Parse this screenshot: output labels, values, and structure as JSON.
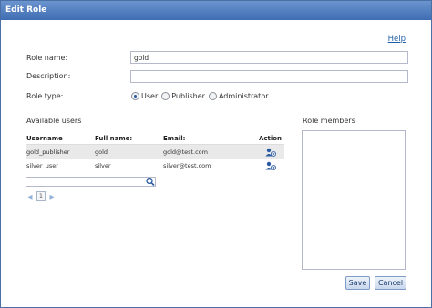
{
  "title": "Edit Role",
  "help_label": "Help",
  "form": {
    "role_name_label": "Role name:",
    "role_name_value": "gold",
    "description_label": "Description:",
    "description_value": "",
    "role_type_label": "Role type:",
    "role_types": [
      "User",
      "Publisher",
      "Administrator"
    ],
    "role_type_selected": "User"
  },
  "available_users": {
    "title": "Available users",
    "columns": [
      "Username",
      "Full name:",
      "Email:",
      "Action"
    ],
    "rows": [
      {
        "username": "gold_publisher",
        "fullname": "gold",
        "email": "gold@test.com",
        "selected": true
      },
      {
        "username": "silver_user",
        "fullname": "silver",
        "email": "silver@test.com",
        "selected": false
      }
    ],
    "search_value": "",
    "pager": {
      "prev": "◀",
      "page": "1",
      "next": "▶"
    }
  },
  "role_members": {
    "title": "Role members",
    "items": []
  },
  "buttons": {
    "save": "Save",
    "cancel": "Cancel"
  },
  "colors": {
    "titlebar": "#4a78bd",
    "link": "#1f5fa8",
    "selected_row": "#e9e9e9",
    "accent_icon": "#2a5aa0"
  }
}
